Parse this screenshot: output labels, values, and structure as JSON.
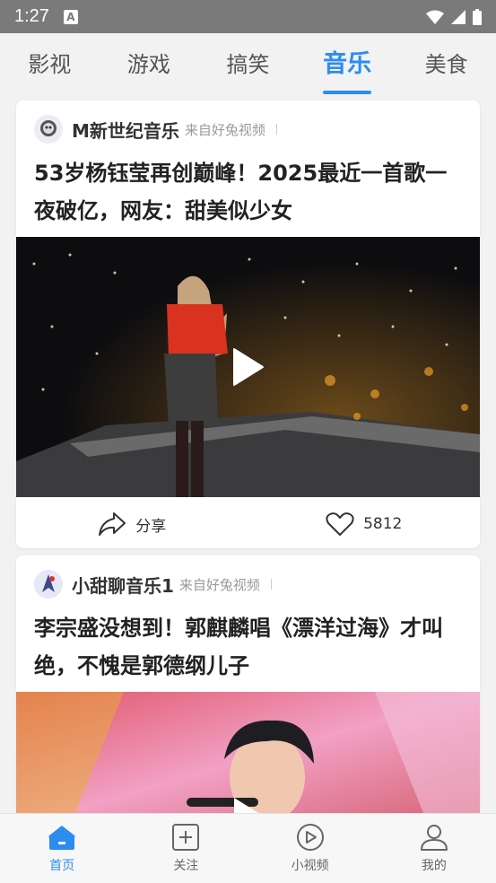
{
  "status_bar": {
    "time": "1:27",
    "notification_letter": "A"
  },
  "tabs": [
    {
      "label": "影视"
    },
    {
      "label": "游戏"
    },
    {
      "label": "搞笑"
    },
    {
      "label": "音乐",
      "active": true
    },
    {
      "label": "美食"
    }
  ],
  "cards": [
    {
      "author": "M新世纪音乐",
      "source": "来自好兔视频",
      "title": "53岁杨钰莹再创巅峰！2025最近一首歌一夜破亿，网友：甜美似少女",
      "share_label": "分享",
      "like_count": "5812"
    },
    {
      "author": "小甜聊音乐1",
      "source": "来自好兔视频",
      "title": "李宗盛没想到！郭麒麟唱《漂洋过海》才叫绝，不愧是郭德纲儿子"
    }
  ],
  "bottom_nav": [
    {
      "label": "首页",
      "icon": "home-icon",
      "active": true
    },
    {
      "label": "关注",
      "icon": "add-square-icon"
    },
    {
      "label": "小视频",
      "icon": "play-circle-icon"
    },
    {
      "label": "我的",
      "icon": "user-icon"
    }
  ],
  "colors": {
    "accent": "#2d8cf0",
    "status_bar": "#7a7a7a"
  }
}
